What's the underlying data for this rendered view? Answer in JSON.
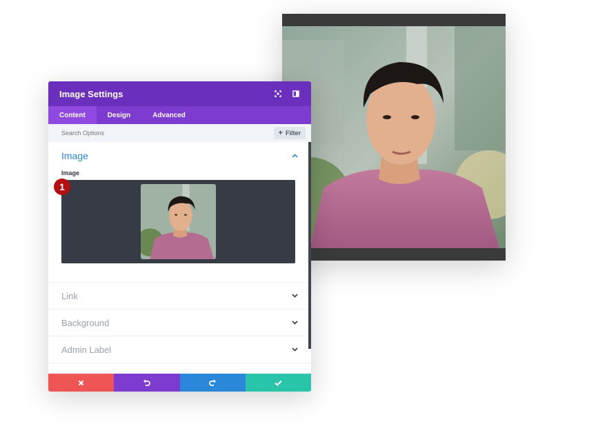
{
  "panel": {
    "title": "Image Settings",
    "tabs": [
      {
        "label": "Content"
      },
      {
        "label": "Design"
      },
      {
        "label": "Advanced"
      }
    ],
    "search": {
      "placeholder": "Search Options",
      "filter_label": "Filter"
    },
    "sections": {
      "image": {
        "title": "Image",
        "field_label": "Image"
      },
      "link": {
        "title": "Link"
      },
      "background": {
        "title": "Background"
      },
      "admin_label": {
        "title": "Admin Label"
      }
    }
  },
  "badge": {
    "number": "1"
  },
  "colors": {
    "header": "#6b2fbd",
    "tabs": "#7e3bd0",
    "accent_blue": "#2b87da",
    "cancel": "#ef5555",
    "undo": "#7e3bd0",
    "redo": "#2b87da",
    "save": "#29c4a9",
    "badge": "#b50e0e"
  },
  "icons": {
    "header": [
      "fullscreen-icon",
      "split-view-icon"
    ],
    "footer": [
      "close-icon",
      "undo-icon",
      "redo-icon",
      "check-icon"
    ]
  }
}
